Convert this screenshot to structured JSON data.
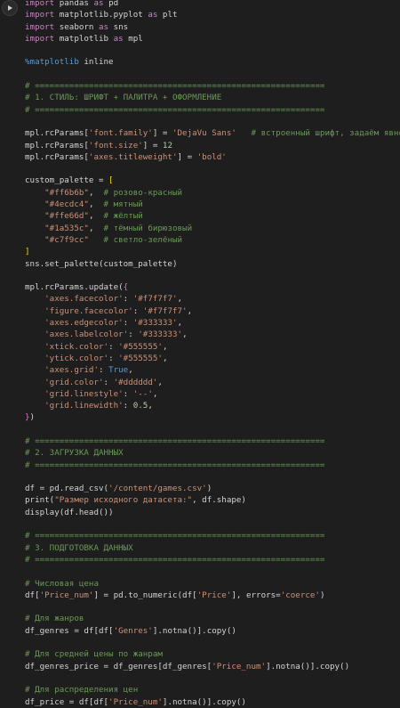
{
  "run_button": {
    "icon": "play-icon"
  },
  "code_lines": [
    [
      {
        "t": "import",
        "c": "kw"
      },
      {
        "t": " pandas "
      },
      {
        "t": "as",
        "c": "kw"
      },
      {
        "t": " pd"
      }
    ],
    [
      {
        "t": "import",
        "c": "kw"
      },
      {
        "t": " matplotlib.pyplot "
      },
      {
        "t": "as",
        "c": "kw"
      },
      {
        "t": " plt"
      }
    ],
    [
      {
        "t": "import",
        "c": "kw"
      },
      {
        "t": " seaborn "
      },
      {
        "t": "as",
        "c": "kw"
      },
      {
        "t": " sns"
      }
    ],
    [
      {
        "t": "import",
        "c": "kw"
      },
      {
        "t": " matplotlib "
      },
      {
        "t": "as",
        "c": "kw"
      },
      {
        "t": " mpl"
      }
    ],
    [],
    [
      {
        "t": "%matplotlib",
        "c": "mag"
      },
      {
        "t": " inline"
      }
    ],
    [],
    [
      {
        "t": "# ===========================================================",
        "c": "cmt"
      }
    ],
    [
      {
        "t": "# 1. СТИЛЬ: ШРИФТ + ПАЛИТРА + ОФОРМЛЕНИЕ",
        "c": "cmt"
      }
    ],
    [
      {
        "t": "# ===========================================================",
        "c": "cmt"
      }
    ],
    [],
    [
      {
        "t": "mpl.rcParams["
      },
      {
        "t": "'font.family'",
        "c": "str"
      },
      {
        "t": "] = "
      },
      {
        "t": "'DejaVu Sans'",
        "c": "str"
      },
      {
        "t": "   "
      },
      {
        "t": "# встроенный шрифт, задаём явно",
        "c": "cmt"
      }
    ],
    [
      {
        "t": "mpl.rcParams["
      },
      {
        "t": "'font.size'",
        "c": "str"
      },
      {
        "t": "] = "
      },
      {
        "t": "12",
        "c": "num"
      }
    ],
    [
      {
        "t": "mpl.rcParams["
      },
      {
        "t": "'axes.titleweight'",
        "c": "str"
      },
      {
        "t": "] = "
      },
      {
        "t": "'bold'",
        "c": "str"
      }
    ],
    [],
    [
      {
        "t": "custom_palette = "
      },
      {
        "t": "[",
        "c": "brk"
      }
    ],
    [
      {
        "t": "    "
      },
      {
        "t": "\"#ff6b6b\"",
        "c": "str"
      },
      {
        "t": ",  "
      },
      {
        "t": "# розово-красный",
        "c": "cmt"
      }
    ],
    [
      {
        "t": "    "
      },
      {
        "t": "\"#4ecdc4\"",
        "c": "str"
      },
      {
        "t": ",  "
      },
      {
        "t": "# мятный",
        "c": "cmt"
      }
    ],
    [
      {
        "t": "    "
      },
      {
        "t": "\"#ffe66d\"",
        "c": "str"
      },
      {
        "t": ",  "
      },
      {
        "t": "# жёлтый",
        "c": "cmt"
      }
    ],
    [
      {
        "t": "    "
      },
      {
        "t": "\"#1a535c\"",
        "c": "str"
      },
      {
        "t": ",  "
      },
      {
        "t": "# тёмный бирюзовый",
        "c": "cmt"
      }
    ],
    [
      {
        "t": "    "
      },
      {
        "t": "\"#c7f9cc\"",
        "c": "str"
      },
      {
        "t": "   "
      },
      {
        "t": "# светло-зелёный",
        "c": "cmt"
      }
    ],
    [
      {
        "t": "]",
        "c": "brk"
      }
    ],
    [
      {
        "t": "sns.set_palette(custom_palette)"
      }
    ],
    [],
    [
      {
        "t": "mpl.rcParams.update("
      },
      {
        "t": "{",
        "c": "brk2"
      }
    ],
    [
      {
        "t": "    "
      },
      {
        "t": "'axes.facecolor'",
        "c": "str"
      },
      {
        "t": ": "
      },
      {
        "t": "'#f7f7f7'",
        "c": "str"
      },
      {
        "t": ","
      }
    ],
    [
      {
        "t": "    "
      },
      {
        "t": "'figure.facecolor'",
        "c": "str"
      },
      {
        "t": ": "
      },
      {
        "t": "'#f7f7f7'",
        "c": "str"
      },
      {
        "t": ","
      }
    ],
    [
      {
        "t": "    "
      },
      {
        "t": "'axes.edgecolor'",
        "c": "str"
      },
      {
        "t": ": "
      },
      {
        "t": "'#333333'",
        "c": "str"
      },
      {
        "t": ","
      }
    ],
    [
      {
        "t": "    "
      },
      {
        "t": "'axes.labelcolor'",
        "c": "str"
      },
      {
        "t": ": "
      },
      {
        "t": "'#333333'",
        "c": "str"
      },
      {
        "t": ","
      }
    ],
    [
      {
        "t": "    "
      },
      {
        "t": "'xtick.color'",
        "c": "str"
      },
      {
        "t": ": "
      },
      {
        "t": "'#555555'",
        "c": "str"
      },
      {
        "t": ","
      }
    ],
    [
      {
        "t": "    "
      },
      {
        "t": "'ytick.color'",
        "c": "str"
      },
      {
        "t": ": "
      },
      {
        "t": "'#555555'",
        "c": "str"
      },
      {
        "t": ","
      }
    ],
    [
      {
        "t": "    "
      },
      {
        "t": "'axes.grid'",
        "c": "str"
      },
      {
        "t": ": "
      },
      {
        "t": "True",
        "c": "bool"
      },
      {
        "t": ","
      }
    ],
    [
      {
        "t": "    "
      },
      {
        "t": "'grid.color'",
        "c": "str"
      },
      {
        "t": ": "
      },
      {
        "t": "'#dddddd'",
        "c": "str"
      },
      {
        "t": ","
      }
    ],
    [
      {
        "t": "    "
      },
      {
        "t": "'grid.linestyle'",
        "c": "str"
      },
      {
        "t": ": "
      },
      {
        "t": "'--'",
        "c": "str"
      },
      {
        "t": ","
      }
    ],
    [
      {
        "t": "    "
      },
      {
        "t": "'grid.linewidth'",
        "c": "str"
      },
      {
        "t": ": "
      },
      {
        "t": "0.5",
        "c": "num"
      },
      {
        "t": ","
      }
    ],
    [
      {
        "t": "}",
        "c": "brk2"
      },
      {
        "t": ")"
      }
    ],
    [],
    [
      {
        "t": "# ===========================================================",
        "c": "cmt"
      }
    ],
    [
      {
        "t": "# 2. ЗАГРУЗКА ДАННЫХ",
        "c": "cmt"
      }
    ],
    [
      {
        "t": "# ===========================================================",
        "c": "cmt"
      }
    ],
    [],
    [
      {
        "t": "df = pd.read_csv("
      },
      {
        "t": "'/content/games.csv'",
        "c": "str"
      },
      {
        "t": ")"
      }
    ],
    [
      {
        "t": "print("
      },
      {
        "t": "\"Размер исходного датасета:\"",
        "c": "str"
      },
      {
        "t": ", df.shape)"
      }
    ],
    [
      {
        "t": "display(df.head())"
      }
    ],
    [],
    [
      {
        "t": "# ===========================================================",
        "c": "cmt"
      }
    ],
    [
      {
        "t": "# 3. ПОДГОТОВКА ДАННЫХ",
        "c": "cmt"
      }
    ],
    [
      {
        "t": "# ===========================================================",
        "c": "cmt"
      }
    ],
    [],
    [
      {
        "t": "# Числовая цена",
        "c": "cmt"
      }
    ],
    [
      {
        "t": "df["
      },
      {
        "t": "'Price_num'",
        "c": "str"
      },
      {
        "t": "] = pd.to_numeric(df["
      },
      {
        "t": "'Price'",
        "c": "str"
      },
      {
        "t": "], errors="
      },
      {
        "t": "'coerce'",
        "c": "str"
      },
      {
        "t": ")"
      }
    ],
    [],
    [
      {
        "t": "# Для жанров",
        "c": "cmt"
      }
    ],
    [
      {
        "t": "df_genres = df[df["
      },
      {
        "t": "'Genres'",
        "c": "str"
      },
      {
        "t": "].notna()].copy()"
      }
    ],
    [],
    [
      {
        "t": "# Для средней цены по жанрам",
        "c": "cmt"
      }
    ],
    [
      {
        "t": "df_genres_price = df_genres[df_genres["
      },
      {
        "t": "'Price_num'",
        "c": "str"
      },
      {
        "t": "].notna()].copy()"
      }
    ],
    [],
    [
      {
        "t": "# Для распределения цен",
        "c": "cmt"
      }
    ],
    [
      {
        "t": "df_price = df[df["
      },
      {
        "t": "'Price_num'",
        "c": "str"
      },
      {
        "t": "].notna()].copy()"
      }
    ]
  ]
}
